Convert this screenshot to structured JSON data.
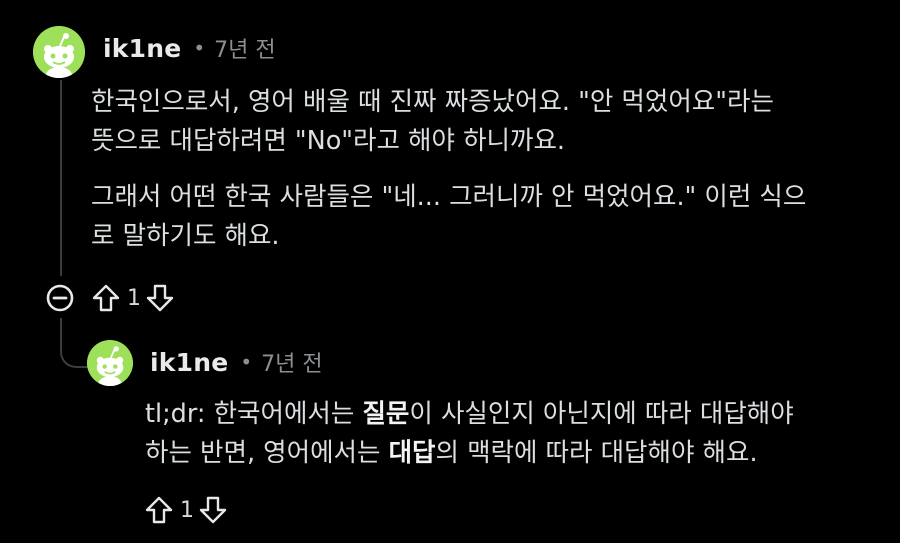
{
  "colors": {
    "background": "#000000",
    "avatar": "#9ee05a",
    "thread_line": "#3a3c3e",
    "muted_text": "#8b8f92"
  },
  "comments": [
    {
      "username": "ik1ne",
      "separator": "•",
      "timestamp": "7년 전",
      "avatar_icon": "reddit-snoo-avatar",
      "paragraphs": [
        {
          "line1": "한국인으로서, 영어 배울 때 진짜 짜증났어요. \"안 먹었어요\"라는",
          "line2": "뜻으로 대답하려면 \"No\"라고 해야 하니까요."
        },
        {
          "line1": "그래서 어떤 한국 사람들은 \"네... 그러니까 안 먹었어요.\" 이런 식으",
          "line2": "로 말하기도 해요."
        }
      ],
      "votes": "1",
      "collapse_icon": "collapse-minus-icon"
    },
    {
      "username": "ik1ne",
      "separator": "•",
      "timestamp": "7년 전",
      "avatar_icon": "reddit-snoo-avatar",
      "line1_pre": "tl;dr: 한국어에서는 ",
      "line1_bold": "질문",
      "line1_post": "이 사실인지 아닌지에 따라 대답해야",
      "line2_pre": "하는 반면, 영어에서는 ",
      "line2_bold": "대답",
      "line2_post": "의 맥락에 따라 대답해야 해요.",
      "votes": "1"
    }
  ]
}
